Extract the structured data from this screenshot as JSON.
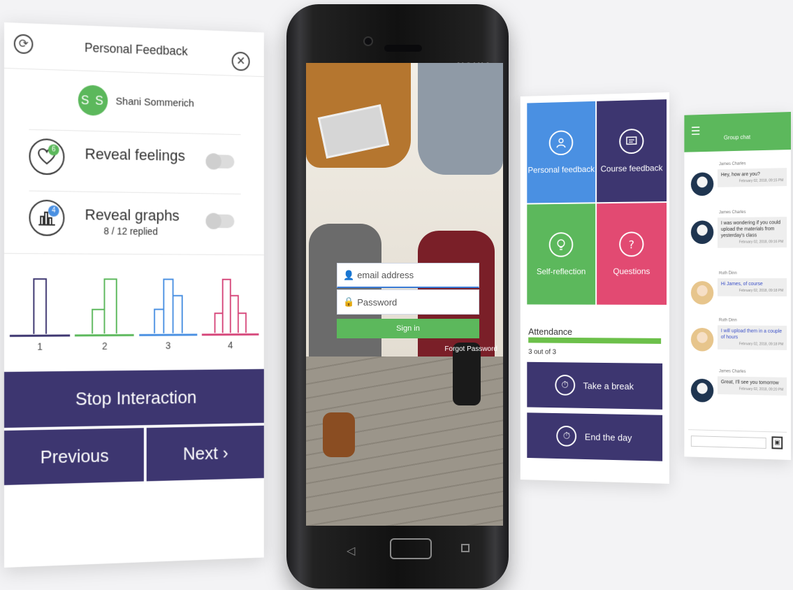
{
  "feedback_panel": {
    "title": "Personal Feedback",
    "icons": {
      "refresh": "refresh-icon",
      "close": "close-icon"
    },
    "user": {
      "initials": "S S",
      "name": "Shani Sommerich"
    },
    "feelings": {
      "label": "Reveal feelings",
      "badge": "6",
      "icon": "heart-icon",
      "toggle_on": false
    },
    "graphs": {
      "label": "Reveal graphs",
      "sub": "8 / 12 replied",
      "badge": "4",
      "icon": "bar-graph-icon",
      "toggle_on": false
    },
    "graph_options": [
      {
        "label": "1",
        "color": "#3d3670"
      },
      {
        "label": "2",
        "color": "#5cb85c"
      },
      {
        "label": "3",
        "color": "#4a90e2"
      },
      {
        "label": "4",
        "color": "#d6467a"
      }
    ],
    "buttons": {
      "stop": "Stop Interaction",
      "previous": "Previous",
      "next": "Next ›"
    }
  },
  "phone": {
    "brand": "NOKIA",
    "login": {
      "email_placeholder": "email address",
      "password_placeholder": "Password",
      "sign_in": "Sign in",
      "forgot": "Forgot Password"
    }
  },
  "menu_panel": {
    "tiles": [
      {
        "label": "Personal feedback",
        "icon": "person-icon",
        "color": "#4a90e2"
      },
      {
        "label": "Course feedback",
        "icon": "message-icon",
        "color": "#3d3670"
      },
      {
        "label": "Self-reflection",
        "icon": "bulb-icon",
        "color": "#5cb85c"
      },
      {
        "label": "Questions",
        "icon": "question-icon",
        "color": "#e24a72"
      }
    ],
    "attendance": {
      "label": "Attendance",
      "count": "3 out of 3",
      "fraction": 1.0
    },
    "buttons": [
      {
        "label": "Take a break",
        "icon": "timer-icon"
      },
      {
        "label": "End the day",
        "icon": "timer-icon"
      }
    ]
  },
  "chat_panel": {
    "title": "Group chat",
    "messages": [
      {
        "name": "James Charles",
        "text": "Hey, how are you?",
        "time": "February 02, 2018, 09:15 PM",
        "avatar": "dark"
      },
      {
        "name": "James Charles",
        "text": "I was wondering if you could upload the materials from yesterday's class",
        "time": "February 02, 2018, 09:16 PM",
        "avatar": "dark"
      },
      {
        "name": "Ruth Dinn",
        "text": "Hi James, of course",
        "time": "February 02, 2018, 09:18 PM",
        "avatar": "blonde"
      },
      {
        "name": "Ruth Dinn",
        "text": "I will upload them in a couple of hours",
        "time": "February 02, 2018, 09:18 PM",
        "avatar": "blonde"
      },
      {
        "name": "James Charles",
        "text": "Great, I'll see you tomorrow",
        "time": "February 02, 2018, 09:20 PM",
        "avatar": "dark"
      }
    ]
  }
}
